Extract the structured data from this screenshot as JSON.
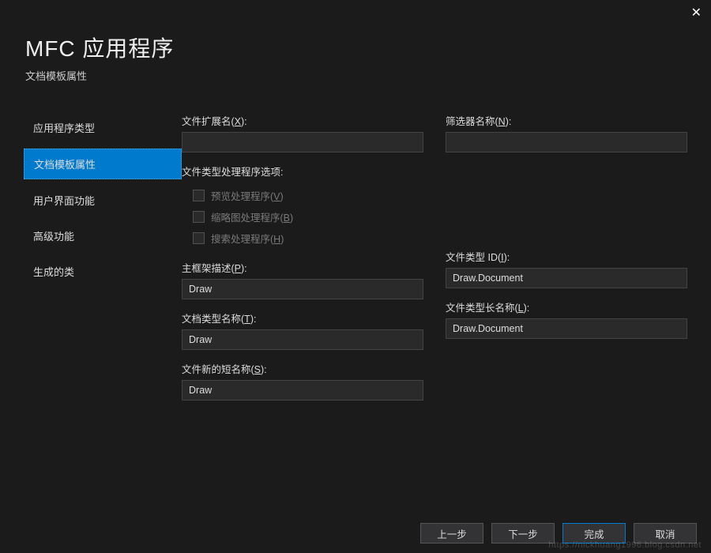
{
  "header": {
    "title": "MFC 应用程序",
    "subtitle": "文档模板属性"
  },
  "sidebar": {
    "items": [
      {
        "label": "应用程序类型"
      },
      {
        "label": "文档模板属性"
      },
      {
        "label": "用户界面功能"
      },
      {
        "label": "高级功能"
      },
      {
        "label": "生成的类"
      }
    ]
  },
  "form": {
    "file_ext": {
      "label_pre": "文件扩展名(",
      "hot": "X",
      "label_post": "):",
      "value": ""
    },
    "filter_name": {
      "label_pre": "筛选器名称(",
      "hot": "N",
      "label_post": "):",
      "value": ""
    },
    "handler_group": {
      "title": "文件类型处理程序选项:",
      "preview": {
        "label_pre": "预览处理程序(",
        "hot": "V",
        "label_post": ")"
      },
      "thumbnail": {
        "label_pre": "缩略图处理程序(",
        "hot": "B",
        "label_post": ")"
      },
      "search": {
        "label_pre": "搜索处理程序(",
        "hot": "H",
        "label_post": ")"
      }
    },
    "mainframe_caption": {
      "label_pre": "主框架描述(",
      "hot": "P",
      "label_post": "):",
      "value": "Draw"
    },
    "filetype_id": {
      "label_pre": "文件类型 ID(",
      "hot": "I",
      "label_post": "):",
      "value": "Draw.Document"
    },
    "doctype_name": {
      "label_pre": "文档类型名称(",
      "hot": "T",
      "label_post": "):",
      "value": "Draw"
    },
    "filetype_longname": {
      "label_pre": "文件类型长名称(",
      "hot": "L",
      "label_post": "):",
      "value": "Draw.Document"
    },
    "file_new_shortname": {
      "label_pre": "文件新的短名称(",
      "hot": "S",
      "label_post": "):",
      "value": "Draw"
    }
  },
  "footer": {
    "back": "上一步",
    "next": "下一步",
    "finish": "完成",
    "cancel": "取消"
  },
  "watermark": "https://nickhuang1996.blog.csdn.net"
}
